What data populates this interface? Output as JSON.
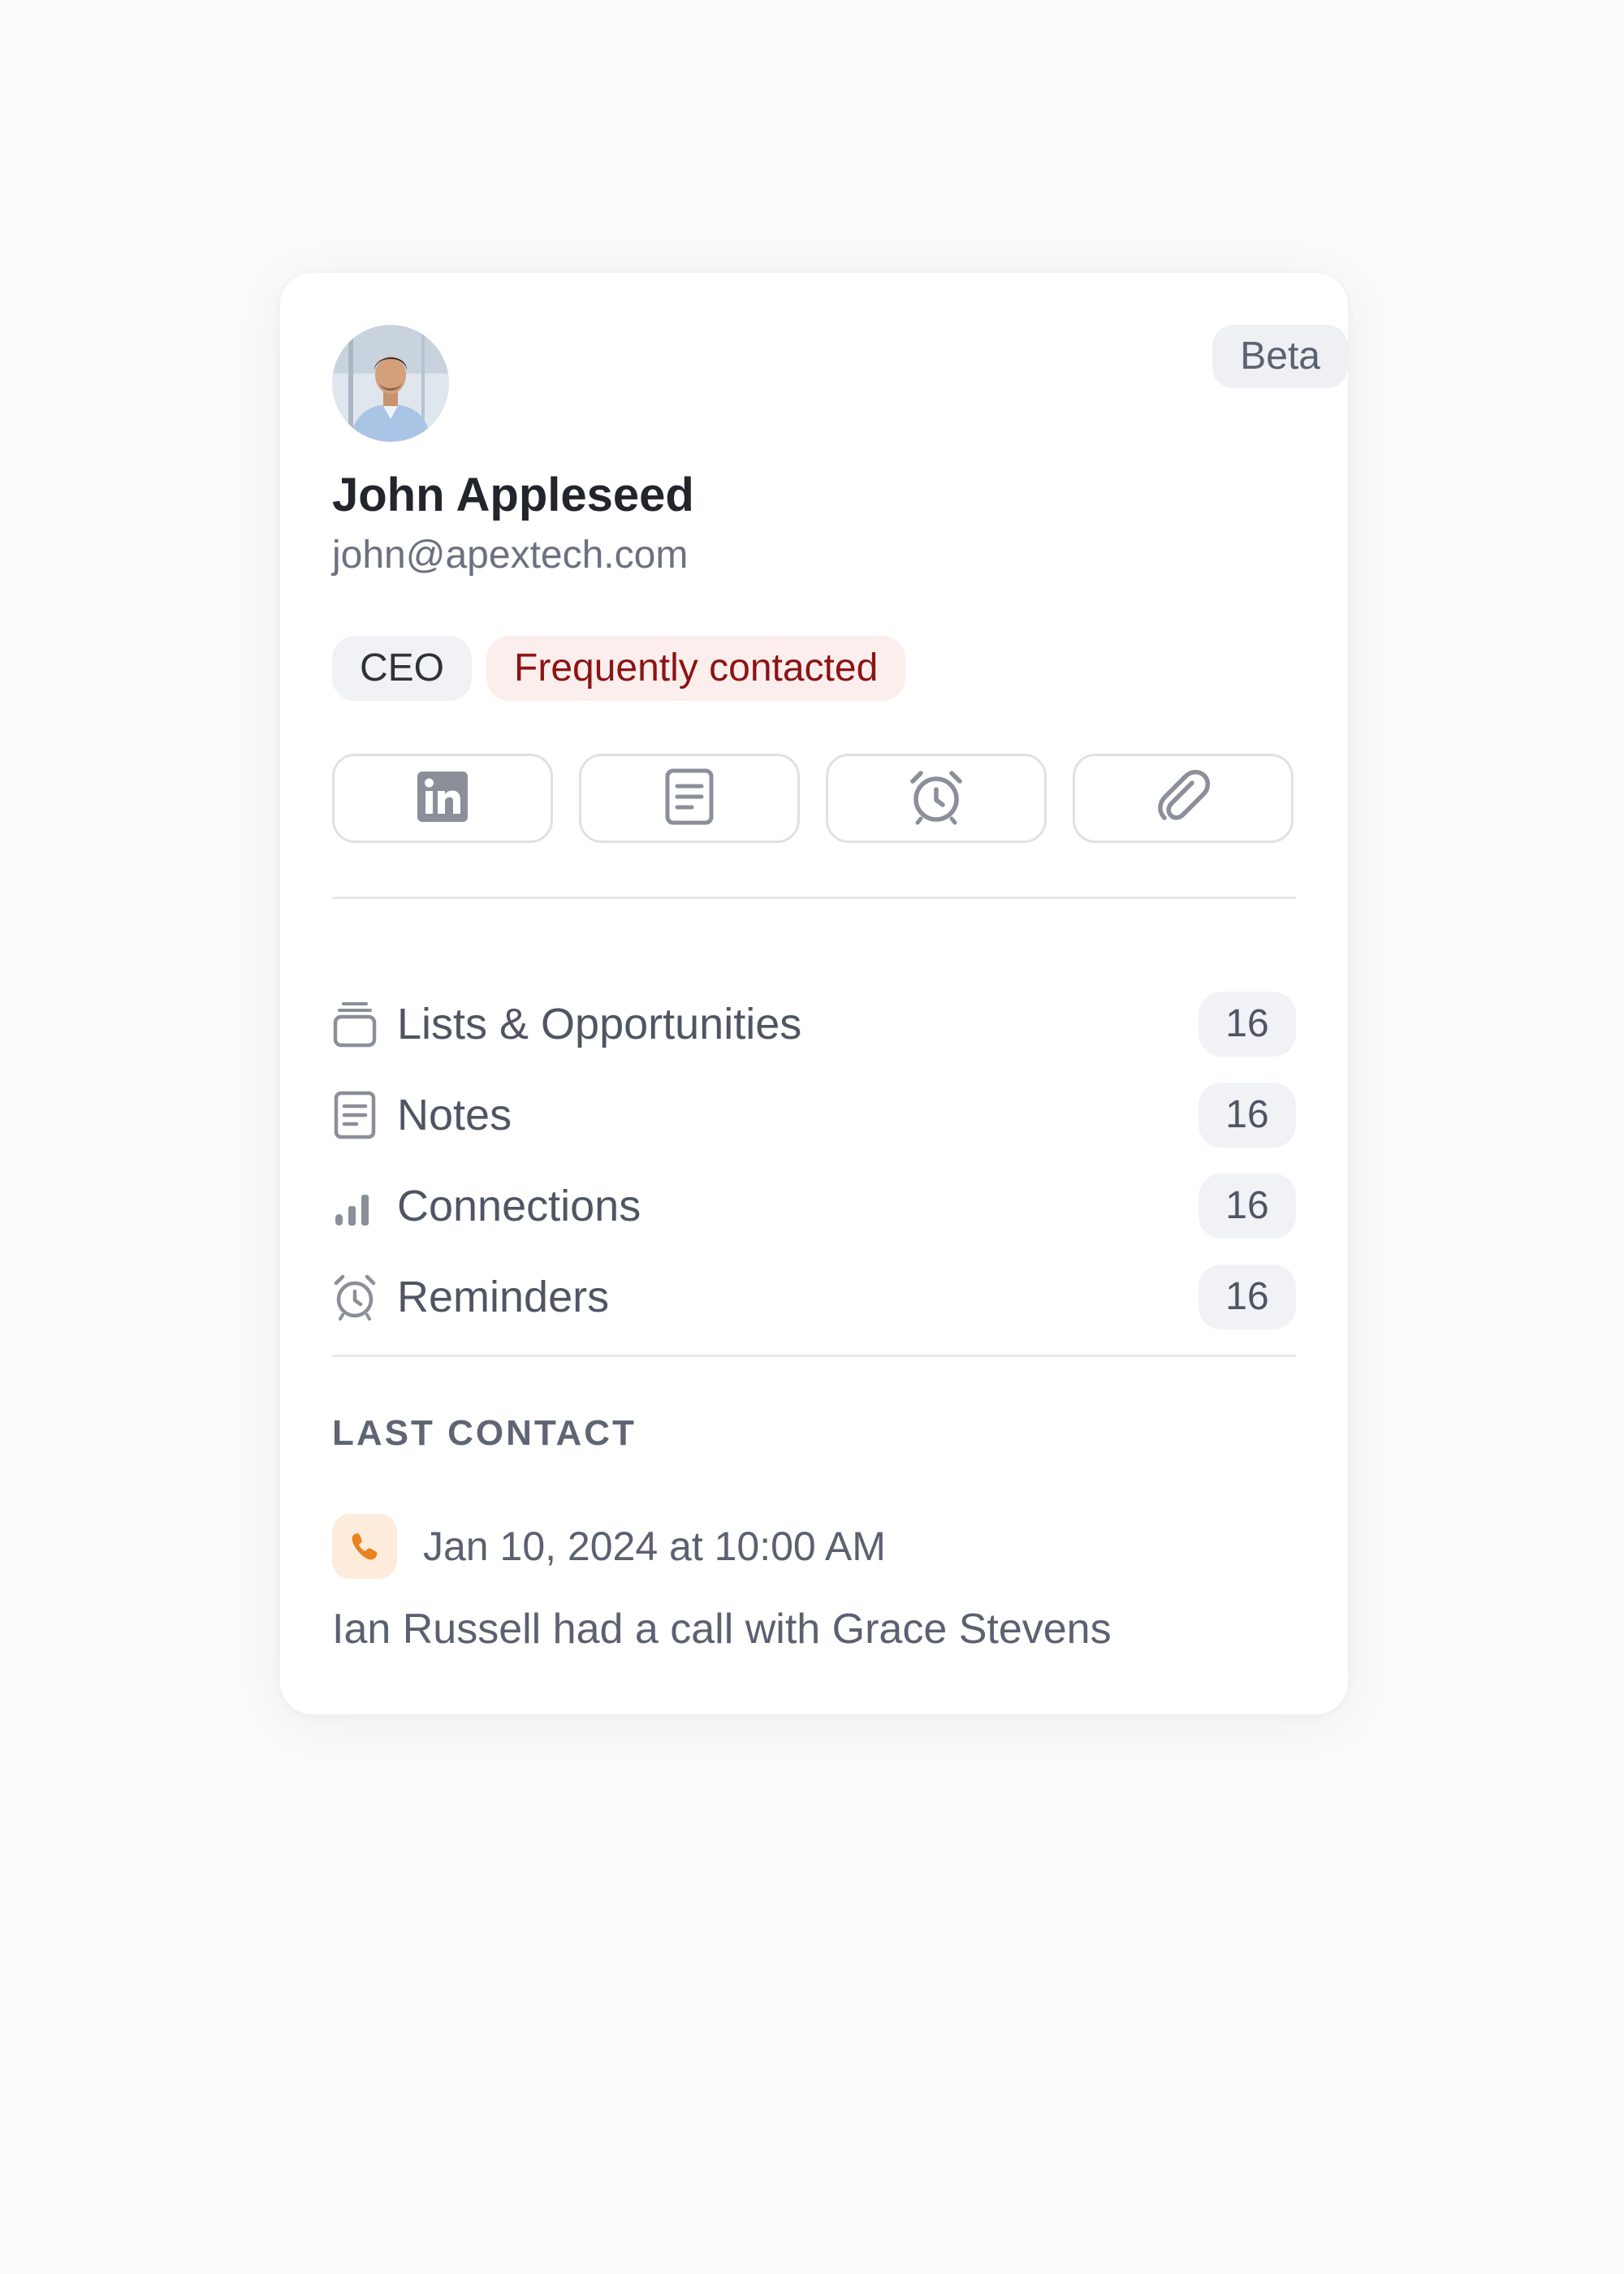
{
  "contact": {
    "name": "John Appleseed",
    "email": "john@apextech.com",
    "beta_badge": "Beta",
    "avatar_icon": "profile-photo"
  },
  "tags": [
    {
      "label": "CEO",
      "style": "neutral"
    },
    {
      "label": "Frequently contacted",
      "style": "danger",
      "color": "#8b1414"
    }
  ],
  "actions": [
    {
      "icon": "linkedin-icon"
    },
    {
      "icon": "document-icon"
    },
    {
      "icon": "alarm-clock-icon"
    },
    {
      "icon": "paperclip-icon"
    }
  ],
  "stats": [
    {
      "icon": "stack-icon",
      "label": "Lists & Opportunities",
      "count": "16"
    },
    {
      "icon": "document-icon",
      "label": "Notes",
      "count": "16"
    },
    {
      "icon": "signal-bars-icon",
      "label": "Connections",
      "count": "16"
    },
    {
      "icon": "alarm-clock-icon",
      "label": "Reminders",
      "count": "16"
    }
  ],
  "last_contact": {
    "section_label": "LAST CONTACT",
    "icon": "phone-icon",
    "timestamp": "Jan 10, 2024 at 10:00 AM",
    "description": "Ian Russell had a call with Grace Stevens"
  },
  "colors": {
    "accent_orange": "#e8821e",
    "tag_red_bg": "#fdeeee",
    "icon_gray": "#8a8f99"
  }
}
